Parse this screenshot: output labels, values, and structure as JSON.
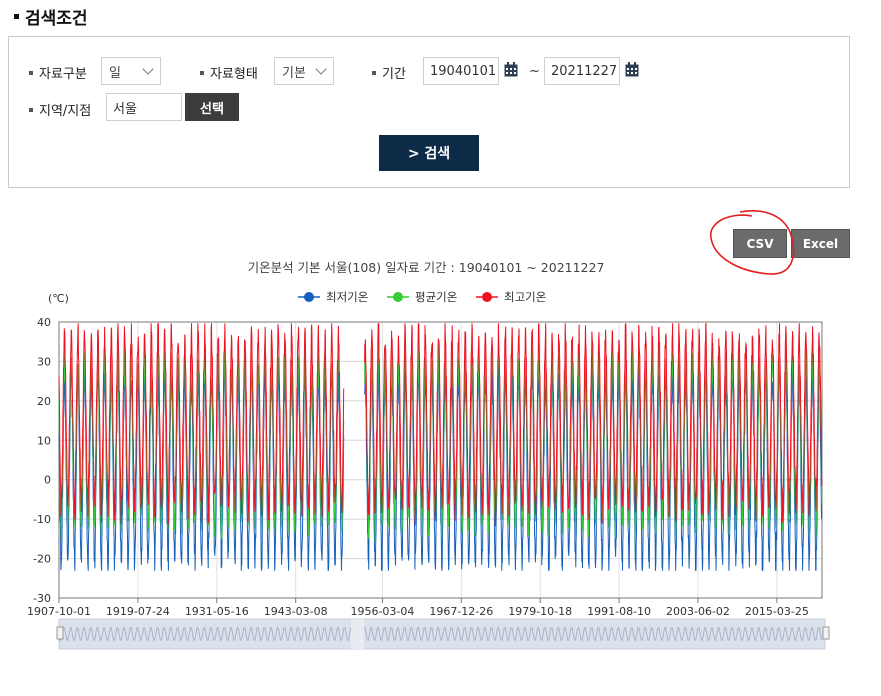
{
  "header": {
    "title": "검색조건"
  },
  "search": {
    "type_label": "자료구분",
    "type_value": "일",
    "form_label": "자료형태",
    "form_value": "기본",
    "period_label": "기간",
    "start_date": "19040101",
    "tilde": "~",
    "end_date": "20211227",
    "region_label": "지역/지점",
    "region_value": "서울",
    "select_button": "선택",
    "search_button": "> 검색"
  },
  "export": {
    "csv_label": "CSV",
    "excel_label": "Excel"
  },
  "colors": {
    "min": "#1560bd",
    "avg": "#33cc33",
    "max": "#ee1122",
    "search_button": "#0d2a47",
    "annotation": "#e02020"
  },
  "icons": {
    "calendar": "calendar-icon",
    "chevron": "chevron-down-icon"
  },
  "chart_data": {
    "type": "line",
    "title": "기온분석 기본 서울(108) 일자료 기간 : 19040101 ~ 20211227",
    "ylabel": "(℃)",
    "xlabel": "",
    "ylim": [
      -30,
      40
    ],
    "yticks": [
      40,
      30,
      20,
      10,
      0,
      -10,
      -20,
      -30
    ],
    "x_tick_labels": [
      "1907-10-01",
      "1919-07-24",
      "1931-05-16",
      "1943-03-08",
      "1956-03-04",
      "1967-12-26",
      "1979-10-18",
      "1991-08-10",
      "2003-06-02",
      "2015-03-25"
    ],
    "x_range": [
      "1907-10-01",
      "2021-12-27"
    ],
    "data_gap": [
      "1950-06",
      "1953-07"
    ],
    "legend_position": "top-center",
    "grid": true,
    "series": [
      {
        "name": "최저기온",
        "color": "#1560bd",
        "summer_peak": 25,
        "winter_trough": -19
      },
      {
        "name": "평균기온",
        "color": "#33cc33",
        "summer_peak": 29,
        "winter_trough": -9
      },
      {
        "name": "최고기온",
        "color": "#ee1122",
        "summer_peak": 35,
        "winter_trough": -5
      }
    ],
    "extremes": {
      "max": 39.6,
      "min": -23
    }
  }
}
